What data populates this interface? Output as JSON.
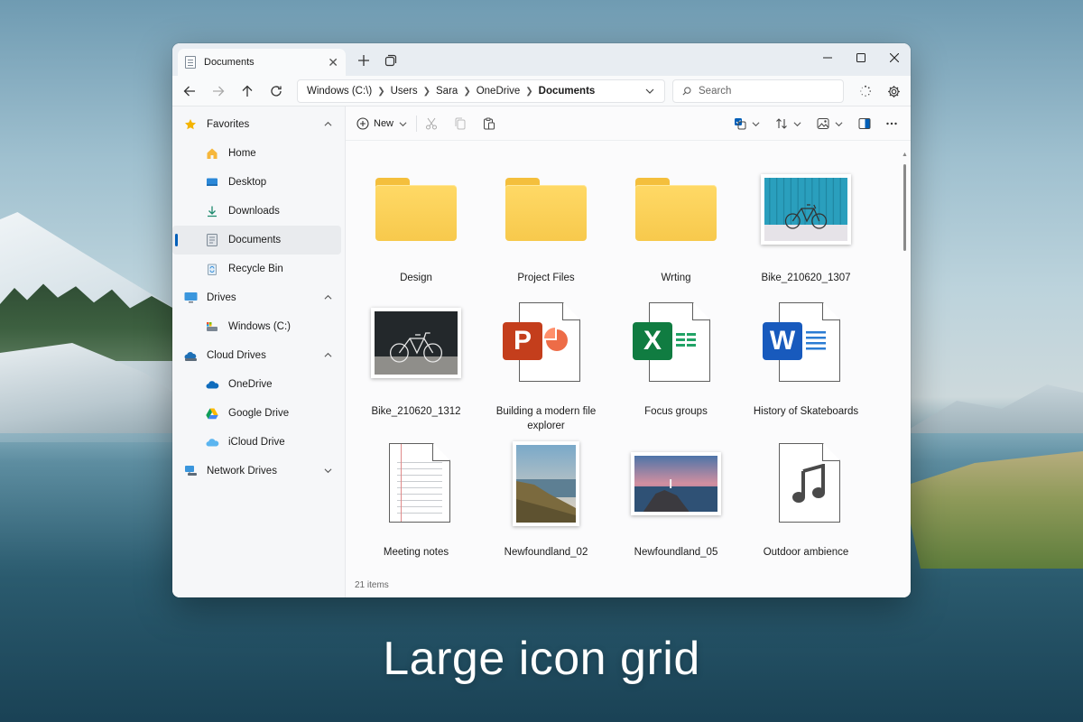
{
  "caption": "Large icon grid",
  "tab": {
    "title": "Documents"
  },
  "breadcrumb": [
    "Windows (C:\\)",
    "Users",
    "Sara",
    "OneDrive",
    "Documents"
  ],
  "search": {
    "placeholder": "Search"
  },
  "toolbar": {
    "new_label": "New"
  },
  "sidebar": {
    "favorites": {
      "label": "Favorites",
      "items": [
        "Home",
        "Desktop",
        "Downloads",
        "Documents",
        "Recycle Bin"
      ]
    },
    "drives": {
      "label": "Drives",
      "items": [
        "Windows (C:)"
      ]
    },
    "cloud": {
      "label": "Cloud Drives",
      "items": [
        "OneDrive",
        "Google Drive",
        "iCloud Drive"
      ]
    },
    "network": {
      "label": "Network Drives"
    }
  },
  "files": [
    {
      "name": "Design",
      "type": "folder"
    },
    {
      "name": "Project Files",
      "type": "folder"
    },
    {
      "name": "Wrting",
      "type": "folder"
    },
    {
      "name": "Bike_210620_1307",
      "type": "photo-bike-blue"
    },
    {
      "name": "Bike_210620_1312",
      "type": "photo-bike-dark"
    },
    {
      "name": "Building a modern file explorer",
      "type": "powerpoint"
    },
    {
      "name": "Focus groups",
      "type": "excel"
    },
    {
      "name": "History of Skateboards",
      "type": "word"
    },
    {
      "name": "Meeting notes",
      "type": "notes"
    },
    {
      "name": "Newfoundland_02",
      "type": "photo-coast"
    },
    {
      "name": "Newfoundland_05",
      "type": "photo-sunset"
    },
    {
      "name": "Outdoor ambience",
      "type": "audio"
    }
  ],
  "status": {
    "count": "21 items"
  },
  "colors": {
    "accent": "#005fb8",
    "folder": "#f7c94c",
    "powerpoint": "#c43e1c",
    "excel": "#107c41",
    "word": "#185abd"
  }
}
